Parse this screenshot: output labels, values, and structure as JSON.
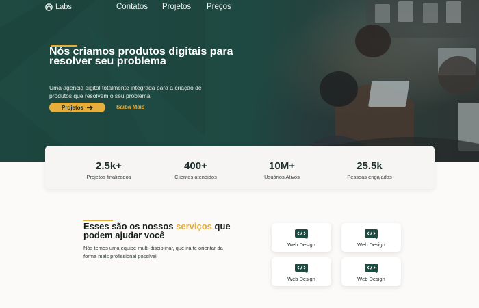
{
  "nav": {
    "logo_text": "Labs",
    "links": [
      "Contatos",
      "Projetos",
      "Preços"
    ]
  },
  "hero": {
    "title": "Nós criamos produtos digitais para resolver seu problema",
    "subtitle": "Uma agência digital totalmente integrada para a criação de produtos que resolvem o seu problema",
    "primary_button": "Projetos",
    "secondary_link": "Saiba Mais"
  },
  "stats": [
    {
      "value": "2.5k+",
      "label": "Projetos finalizados"
    },
    {
      "value": "400+",
      "label": "Clientes atendidos"
    },
    {
      "value": "10M+",
      "label": "Usuários Ativos"
    },
    {
      "value": "25.5k",
      "label": "Pessoas engajadas"
    }
  ],
  "services": {
    "title_part1": "Esses são os nossos ",
    "title_highlight": "serviços",
    "title_part2": " que podem ajudar você",
    "description": "Nós temos uma equipe multi-disciplinar, que irá te orientar da  forma mais profissional possível",
    "cards": [
      {
        "label": "Web Design",
        "icon": "code-tablet-icon"
      },
      {
        "label": "Web Design",
        "icon": "code-tablet-icon"
      },
      {
        "label": "Web Design",
        "icon": "code-tablet-icon"
      },
      {
        "label": "Web Design",
        "icon": "code-tablet-icon"
      }
    ]
  },
  "colors": {
    "hero_bg": "#1e4a42",
    "accent": "#e6ae36",
    "page_bg": "#fcfaf8",
    "stats_bg": "#f7f4f4"
  }
}
